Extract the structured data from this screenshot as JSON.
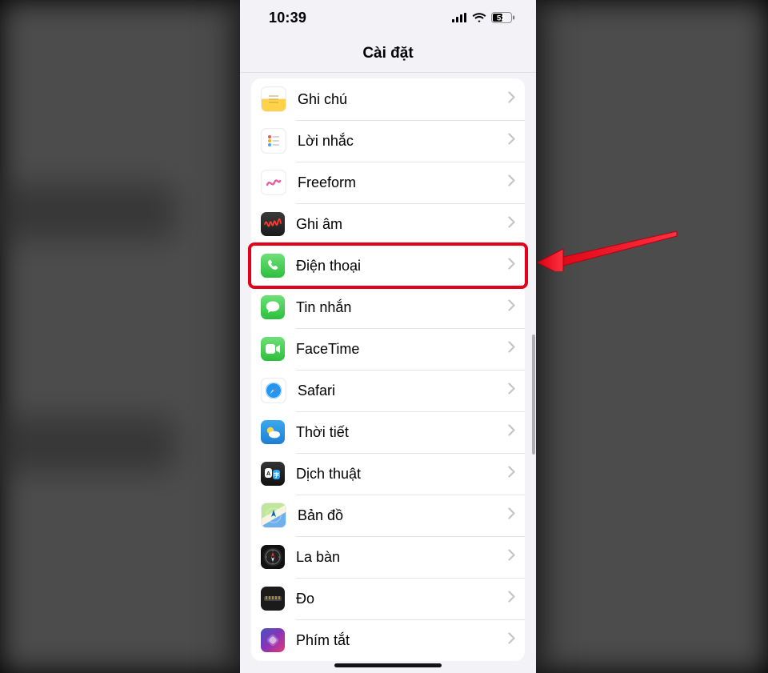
{
  "status": {
    "time": "10:39",
    "battery_text": "52"
  },
  "nav": {
    "title": "Cài đặt"
  },
  "highlight_id": "phone",
  "rows": [
    {
      "id": "notes",
      "label": "Ghi chú",
      "icon": "notes-icon"
    },
    {
      "id": "reminders",
      "label": "Lời nhắc",
      "icon": "reminders-icon"
    },
    {
      "id": "freeform",
      "label": "Freeform",
      "icon": "freeform-icon"
    },
    {
      "id": "voice",
      "label": "Ghi âm",
      "icon": "voice-memos-icon"
    },
    {
      "id": "phone",
      "label": "Điện thoại",
      "icon": "phone-icon"
    },
    {
      "id": "messages",
      "label": "Tin nhắn",
      "icon": "messages-icon"
    },
    {
      "id": "facetime",
      "label": "FaceTime",
      "icon": "facetime-icon"
    },
    {
      "id": "safari",
      "label": "Safari",
      "icon": "safari-icon"
    },
    {
      "id": "weather",
      "label": "Thời tiết",
      "icon": "weather-icon"
    },
    {
      "id": "translate",
      "label": "Dịch thuật",
      "icon": "translate-icon"
    },
    {
      "id": "maps",
      "label": "Bản đồ",
      "icon": "maps-icon"
    },
    {
      "id": "compass",
      "label": "La bàn",
      "icon": "compass-icon"
    },
    {
      "id": "measure",
      "label": "Đo",
      "icon": "measure-icon"
    },
    {
      "id": "shortcuts",
      "label": "Phím tắt",
      "icon": "shortcuts-icon"
    }
  ]
}
